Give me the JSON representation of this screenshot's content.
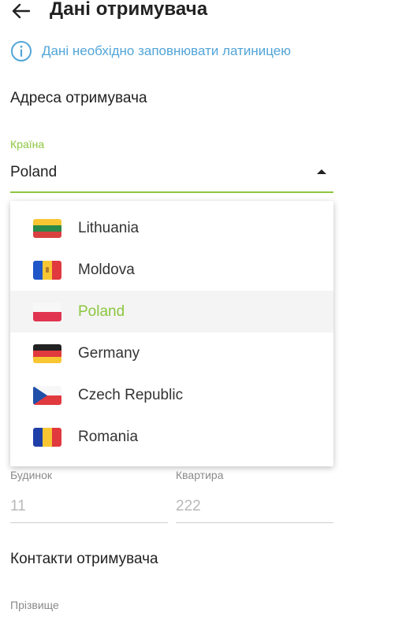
{
  "header": {
    "title": "Дані отримувача",
    "back_icon": "arrow-left-icon"
  },
  "info": {
    "icon": "info-circle-icon",
    "text": "Дані необхідно заповнювати латиницею",
    "color": "#52a5d8"
  },
  "address": {
    "section_title": "Адреса отримувача",
    "country": {
      "label": "Країна",
      "value": "Poland",
      "options": [
        {
          "label": "Lithuania",
          "flag": "lithuania-flag-icon",
          "selected": false
        },
        {
          "label": "Moldova",
          "flag": "moldova-flag-icon",
          "selected": false
        },
        {
          "label": "Poland",
          "flag": "poland-flag-icon",
          "selected": true
        },
        {
          "label": "Germany",
          "flag": "germany-flag-icon",
          "selected": false
        },
        {
          "label": "Czech Republic",
          "flag": "czech-flag-icon",
          "selected": false
        },
        {
          "label": "Romania",
          "flag": "romania-flag-icon",
          "selected": false
        }
      ]
    },
    "house": {
      "label": "Будинок",
      "placeholder": "11"
    },
    "apartment": {
      "label": "Квартира",
      "placeholder": "222"
    }
  },
  "contacts": {
    "section_title": "Контакти отримувача",
    "surname": {
      "label": "Прізвище"
    }
  },
  "colors": {
    "accent": "#8cc63f",
    "info": "#52a5d8",
    "text": "#222222",
    "muted": "#8a8a8a"
  }
}
